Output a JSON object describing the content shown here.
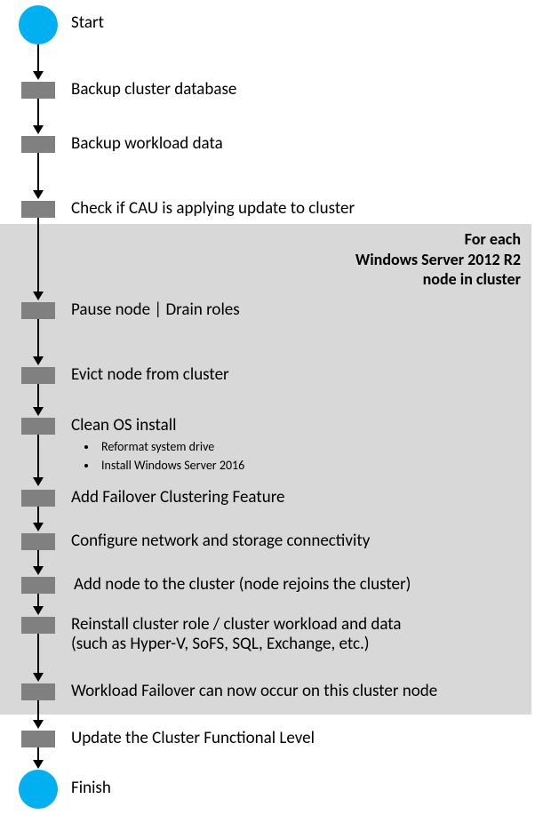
{
  "start": {
    "label": "Start"
  },
  "finish": {
    "label": "Finish"
  },
  "loop": {
    "header_line1": "For each",
    "header_line2": "Windows Server 2012 R2",
    "header_line3": "node in cluster"
  },
  "steps": {
    "s1": "Backup cluster database",
    "s2": "Backup workload data",
    "s3": "Check if CAU is applying update to cluster",
    "s4": "Pause node | Drain roles",
    "s5": "Evict node from cluster",
    "s6": "Clean OS install",
    "s6b1": "Reformat system drive",
    "s6b2": "Install Windows Server 2016",
    "s7": "Add Failover Clustering Feature",
    "s8": "Configure network and storage connectivity",
    "s9": "Add node to the cluster (node rejoins the cluster)",
    "s10a": "Reinstall cluster role / cluster workload and data",
    "s10b": "(such as Hyper-V, SoFS, SQL, Exchange, etc.)",
    "s11": "Workload Failover can now occur on this cluster node",
    "s12": "Update the Cluster Functional Level"
  }
}
